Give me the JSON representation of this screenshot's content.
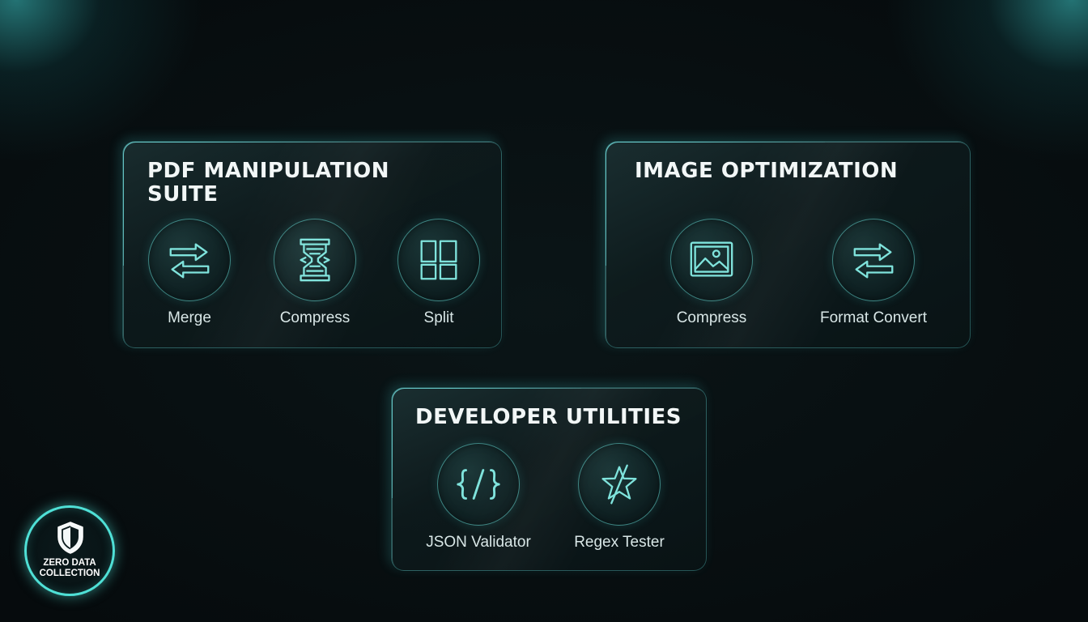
{
  "theme": {
    "accent": "#4fe0d6",
    "icon_stroke": "#7fe3dc",
    "background": "#060b0d"
  },
  "panels": {
    "pdf": {
      "title": "PDF MANIPULATION SUITE",
      "tools": [
        {
          "label": "Merge",
          "icon": "swap-arrows-icon"
        },
        {
          "label": "Compress",
          "icon": "hourglass-compress-icon"
        },
        {
          "label": "Split",
          "icon": "grid-split-icon"
        }
      ]
    },
    "image": {
      "title": "IMAGE OPTIMIZATION",
      "tools": [
        {
          "label": "Compress",
          "icon": "image-icon"
        },
        {
          "label": "Format Convert",
          "icon": "swap-arrows-icon"
        }
      ]
    },
    "developer": {
      "title": "DEVELOPER UTILITIES",
      "tools": [
        {
          "label": "JSON Validator",
          "icon": "code-braces-icon"
        },
        {
          "label": "Regex Tester",
          "icon": "star-slash-icon"
        }
      ]
    }
  },
  "badge": {
    "text": "ZERO DATA\nCOLLECTION",
    "icon": "shield-icon"
  }
}
